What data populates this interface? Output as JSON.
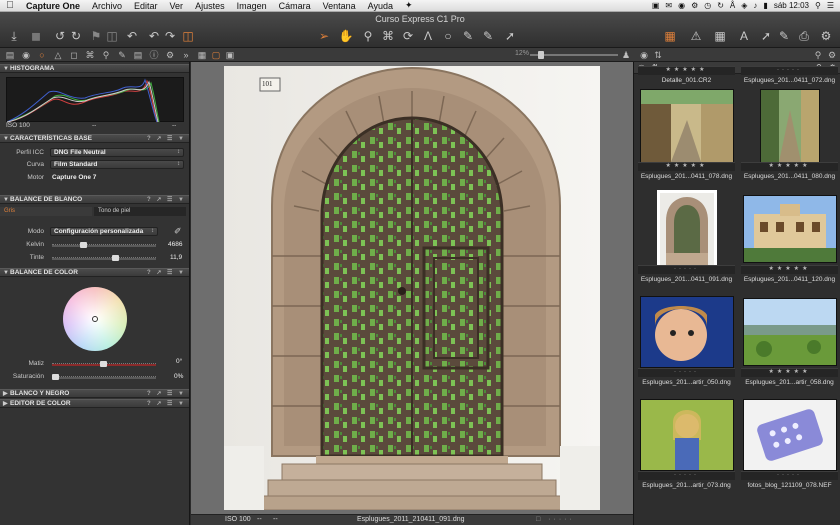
{
  "menubar": {
    "apple_icon": "apple-logo",
    "items": [
      "Capture One",
      "Archivo",
      "Editar",
      "Ver",
      "Ajustes",
      "Imagen",
      "Cámara",
      "Ventana",
      "Ayuda"
    ],
    "clock": "sáb 12:03"
  },
  "window": {
    "title": "Curso Express C1 Pro"
  },
  "left_panel": {
    "histogram": {
      "title": "HISTOGRAMA",
      "iso": "ISO 100",
      "mid": "--",
      "right": "--"
    },
    "base": {
      "title": "CARACTERÍSTICAS BASE",
      "icc_label": "Perfil ICC",
      "icc_value": "DNG File Neutral",
      "curve_label": "Curva",
      "curve_value": "Film Standard",
      "engine_label": "Motor",
      "engine_value": "Capture One 7"
    },
    "white_balance": {
      "title": "BALANCE DE BLANCO",
      "tab_gray": "Gris",
      "tab_skin": "Tono de piel",
      "mode_label": "Modo",
      "mode_value": "Configuración personalizada",
      "kelvin_label": "Kelvin",
      "kelvin_value": "4686",
      "tint_label": "Tinte",
      "tint_value": "11,9"
    },
    "color_balance": {
      "title": "BALANCE DE COLOR",
      "hue_label": "Matiz",
      "hue_value": "0°",
      "sat_label": "Saturación",
      "sat_value": "0%"
    },
    "bw": {
      "title": "BLANCO Y NEGRO"
    },
    "color_editor": {
      "title": "EDITOR DE COLOR"
    }
  },
  "subbar": {
    "zoom": "12%"
  },
  "viewer": {
    "iso": "ISO 100",
    "dash1": "--",
    "dash2": "--",
    "filename": "Esplugues_2011_210411_091.dng",
    "house_number": "101"
  },
  "browser": {
    "thumbnails": [
      {
        "name": "Detalle_001.CR2",
        "stars": 5,
        "selected": false,
        "scene": "top-partial"
      },
      {
        "name": "Esplugues_201...0411_072.dng",
        "stars": 0,
        "selected": false,
        "scene": "top-partial"
      },
      {
        "name": "Esplugues_201...0411_078.dng",
        "stars": 5,
        "selected": false,
        "scene": "alley"
      },
      {
        "name": "Esplugues_201...0411_080.dng",
        "stars": 5,
        "selected": false,
        "scene": "alley-narrow"
      },
      {
        "name": "Esplugues_201...0411_091.dng",
        "stars": 0,
        "selected": true,
        "scene": "door"
      },
      {
        "name": "Esplugues_201...0411_120.dng",
        "stars": 5,
        "selected": false,
        "scene": "building"
      },
      {
        "name": "Esplugues_201...artir_050.dng",
        "stars": 0,
        "selected": false,
        "scene": "child"
      },
      {
        "name": "Esplugues_201...artir_058.dng",
        "stars": 5,
        "selected": false,
        "scene": "landscape"
      },
      {
        "name": "Esplugues_201...artir_073.dng",
        "stars": 0,
        "selected": false,
        "scene": "girl"
      },
      {
        "name": "fotos_blog_121109_078.NEF",
        "stars": 0,
        "selected": false,
        "scene": "device"
      }
    ]
  }
}
